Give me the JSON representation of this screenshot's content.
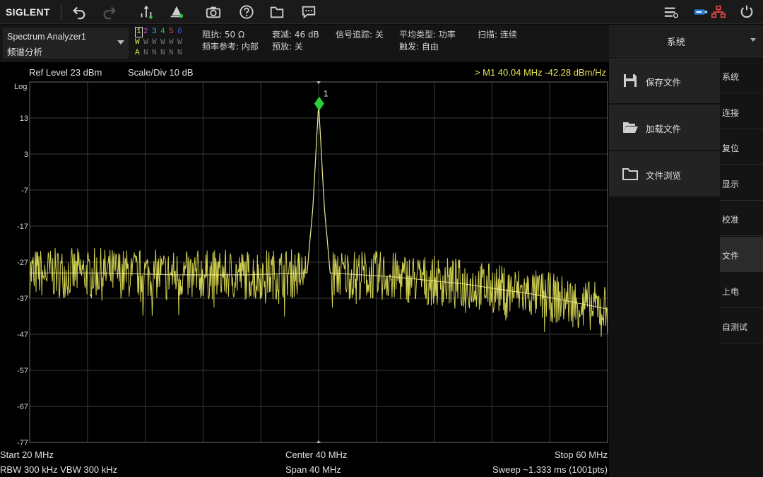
{
  "toolbar": {
    "logo": "SIGLENT",
    "icons": [
      "undo-icon",
      "redo-icon",
      "peak-search-icon",
      "marker-icon",
      "camera-icon",
      "help-icon",
      "folder-icon",
      "message-icon",
      "menu-list-icon",
      "usb-icon",
      "network-icon",
      "power-icon"
    ]
  },
  "mode": {
    "name": "Spectrum Analyzer1",
    "sub": "频谱分析"
  },
  "traces": {
    "numbers": [
      "1",
      "2",
      "3",
      "4",
      "5",
      "6"
    ],
    "number_colors": [
      "#e6e65a",
      "#c24fd0",
      "#3bb4d8",
      "#2fc44a",
      "#e0564c",
      "#3a5fe0"
    ],
    "types": [
      "W",
      "W",
      "W",
      "W",
      "W",
      "W"
    ],
    "states": [
      "A",
      "N",
      "N",
      "N",
      "N",
      "N"
    ]
  },
  "params": {
    "impedance": "阻抗: 50 Ω",
    "freq_ref": "频率参考: 内部",
    "atten": "衰减: 46 dB",
    "preamp": "预放: 关",
    "tracking": "信号追踪: 关",
    "avg_type": "平均类型: 功率",
    "trigger": "触发: 自由",
    "sweep_mode": "扫描: 连续"
  },
  "plot": {
    "ref_level": "Ref Level  23 dBm",
    "scale_div": "Scale/Div  10 dB",
    "marker_readout": ">  M1    40.04 MHz   -42.28 dBm/Hz",
    "scale_type": "Log",
    "y_ticks": [
      "13",
      "3",
      "-7",
      "-17",
      "-27",
      "-37",
      "-47",
      "-57",
      "-67",
      "-77"
    ],
    "marker_label": "1",
    "start": "Start  20 MHz",
    "center": "Center  40 MHz",
    "stop": "Stop  60 MHz",
    "rbw_vbw": "RBW  300 kHz    VBW  300 kHz",
    "span": "Span  40 MHz",
    "sweep": "Sweep   ~1.333 ms (1001pts)",
    "trace_color": "#e6e65a",
    "marker_color": "#2ccf3a"
  },
  "chart_data": {
    "type": "line",
    "xlabel": "",
    "ylabel": "",
    "x_range_mhz": [
      20,
      60
    ],
    "y_range_dbm": [
      -77,
      23
    ],
    "series": [
      {
        "x": [
          20,
          25,
          30,
          35,
          39.2,
          39.6,
          40.0,
          40.4,
          40.8,
          45,
          50,
          55,
          60
        ],
        "y": [
          -30,
          -30,
          -30.5,
          -30.5,
          -30,
          -12,
          17,
          -12,
          -30,
          -31,
          -33,
          -36,
          -40
        ]
      }
    ],
    "marker": {
      "x": 40.04,
      "y": 17
    }
  },
  "side": {
    "title": "系统",
    "softkeys": [
      {
        "label": "保存文件",
        "icon": "save-icon"
      },
      {
        "label": "加载文件",
        "icon": "open-folder-icon"
      },
      {
        "label": "文件浏览",
        "icon": "folder-icon"
      }
    ],
    "tabs": [
      "系统",
      "连接",
      "复位",
      "显示",
      "校准",
      "文件",
      "上电",
      "自测试"
    ],
    "active_tab": 5
  }
}
